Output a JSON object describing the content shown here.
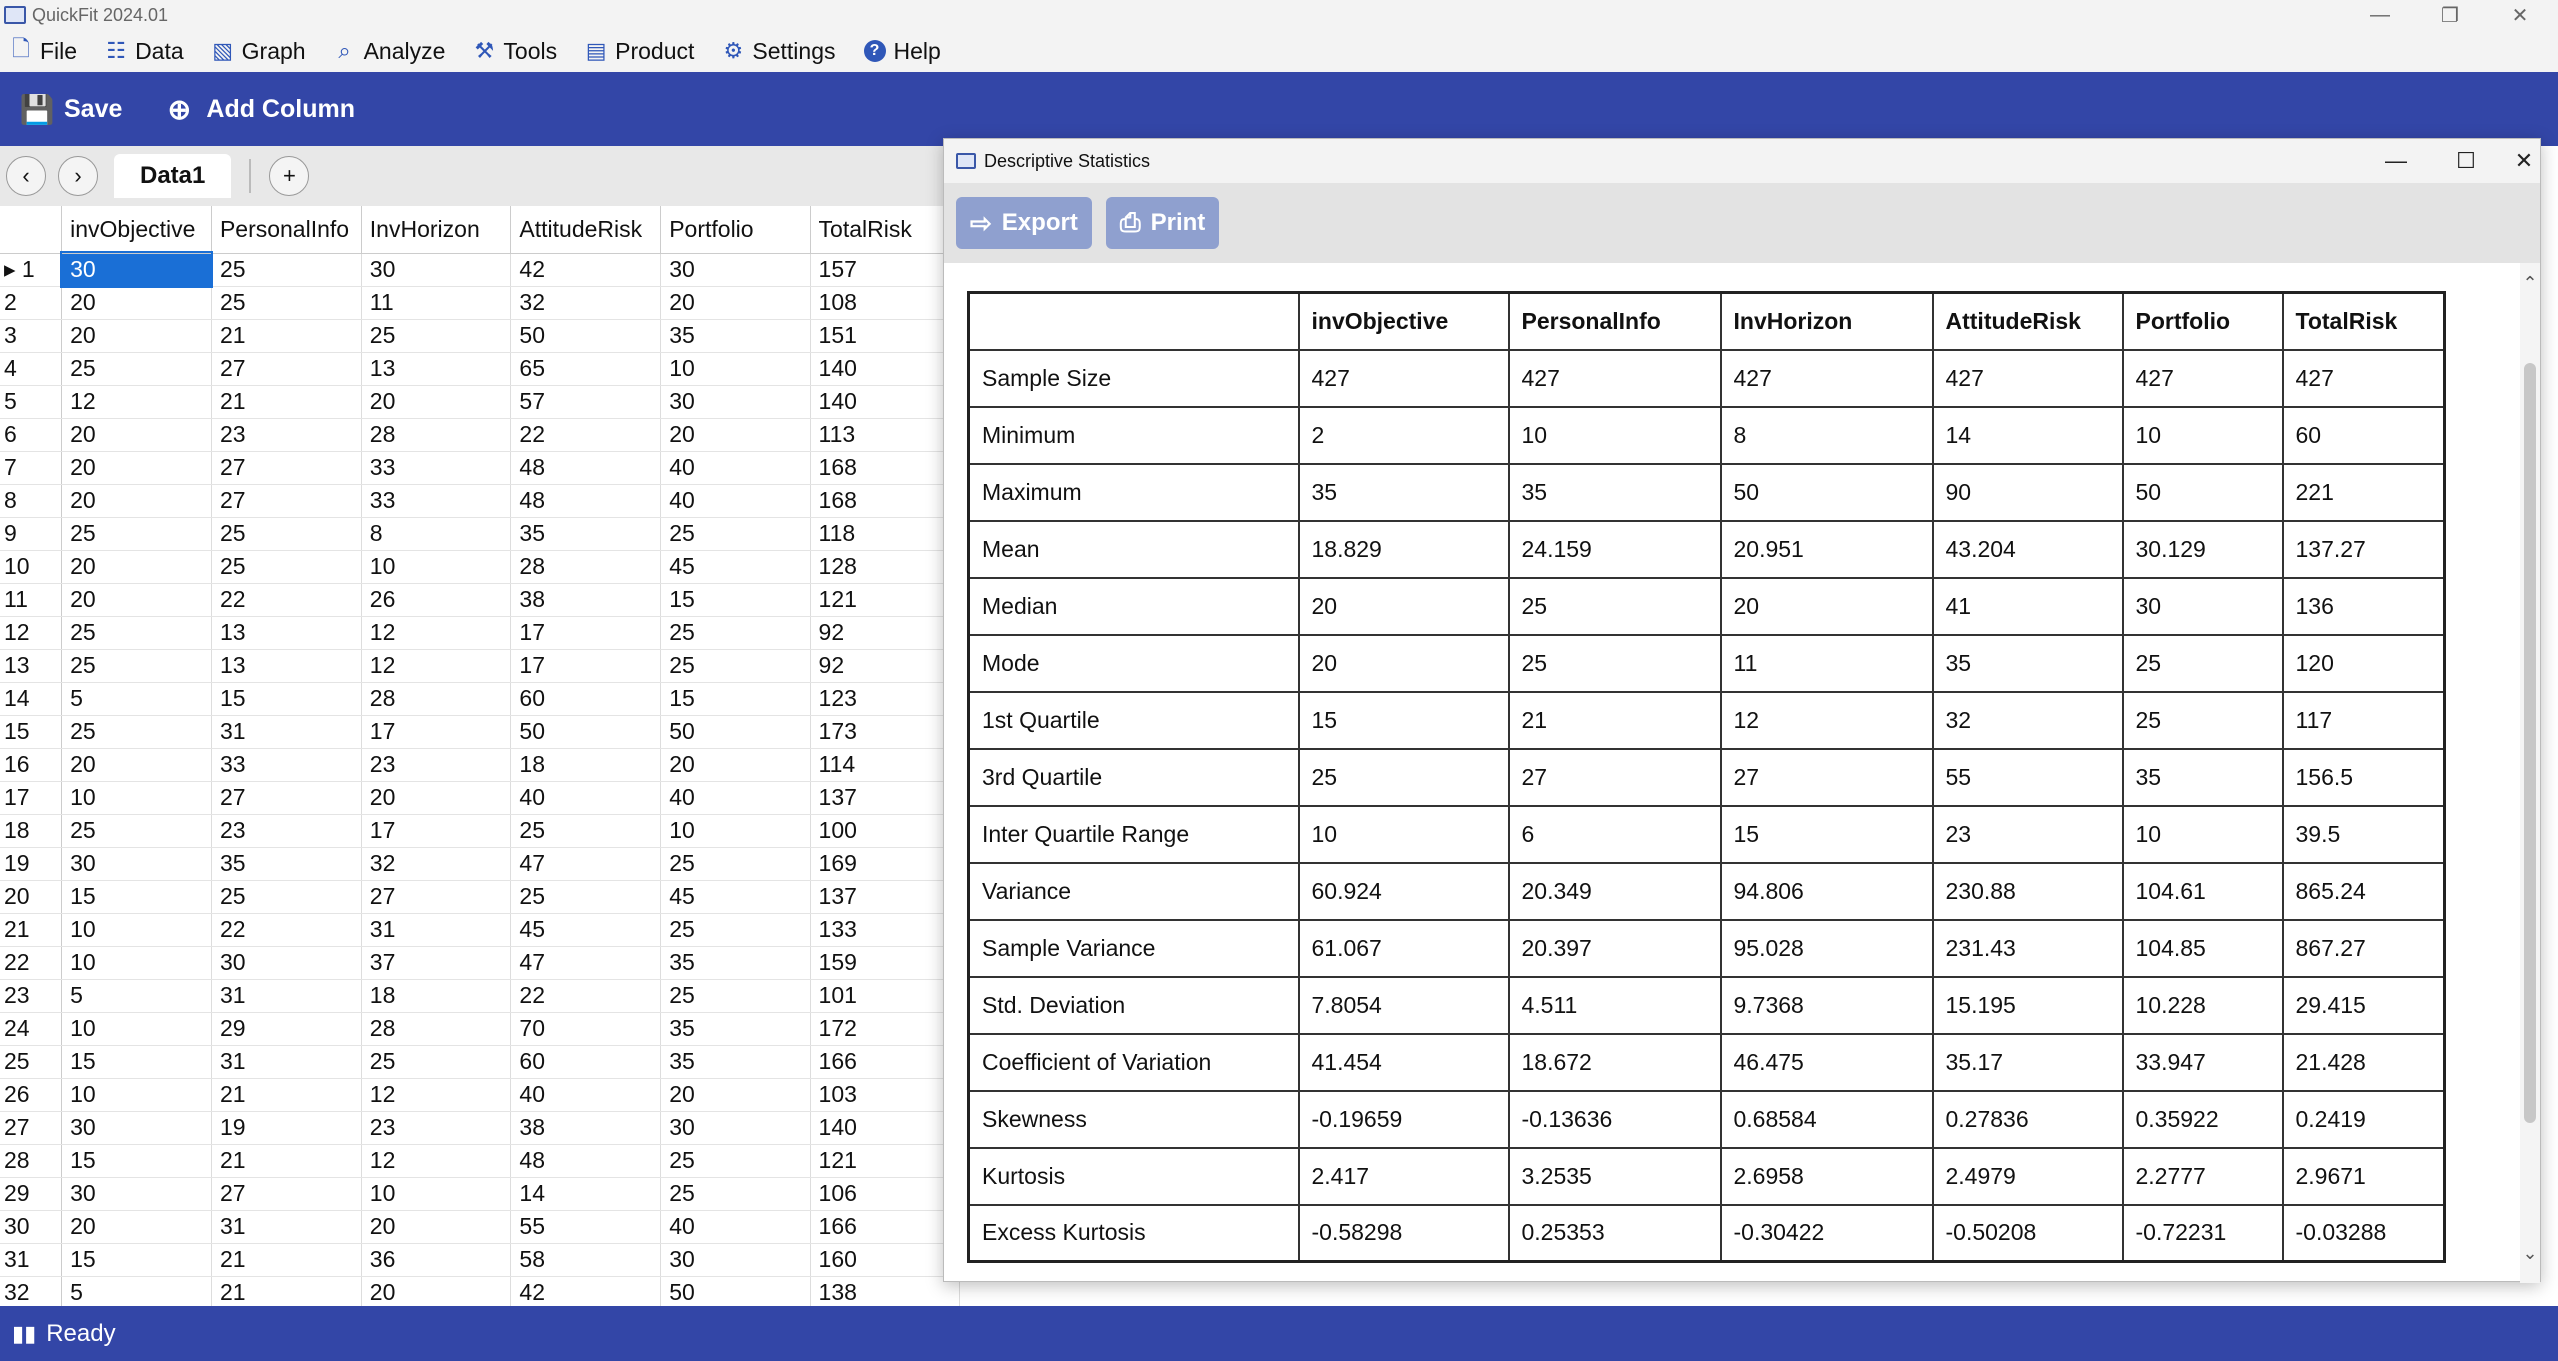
{
  "app": {
    "title": "QuickFit 2024.01"
  },
  "menu": [
    {
      "label": "File",
      "icon": "file-icon"
    },
    {
      "label": "Data",
      "icon": "database-icon"
    },
    {
      "label": "Graph",
      "icon": "graph-icon"
    },
    {
      "label": "Analyze",
      "icon": "analyze-icon"
    },
    {
      "label": "Tools",
      "icon": "tools-icon"
    },
    {
      "label": "Product",
      "icon": "product-icon"
    },
    {
      "label": "Settings",
      "icon": "gear-icon"
    },
    {
      "label": "Help",
      "icon": "help-icon"
    }
  ],
  "toolbar": {
    "save_label": "Save",
    "add_column_label": "Add Column"
  },
  "tabs": {
    "active": "Data1",
    "add": "+"
  },
  "grid": {
    "columns": [
      "invObjective",
      "PersonalInfo",
      "InvHorizon",
      "AttitudeRisk",
      "Portfolio",
      "TotalRisk"
    ],
    "rows": [
      [
        "1",
        "30",
        "25",
        "30",
        "42",
        "30",
        "157"
      ],
      [
        "2",
        "20",
        "25",
        "11",
        "32",
        "20",
        "108"
      ],
      [
        "3",
        "20",
        "21",
        "25",
        "50",
        "35",
        "151"
      ],
      [
        "4",
        "25",
        "27",
        "13",
        "65",
        "10",
        "140"
      ],
      [
        "5",
        "12",
        "21",
        "20",
        "57",
        "30",
        "140"
      ],
      [
        "6",
        "20",
        "23",
        "28",
        "22",
        "20",
        "113"
      ],
      [
        "7",
        "20",
        "27",
        "33",
        "48",
        "40",
        "168"
      ],
      [
        "8",
        "20",
        "27",
        "33",
        "48",
        "40",
        "168"
      ],
      [
        "9",
        "25",
        "25",
        "8",
        "35",
        "25",
        "118"
      ],
      [
        "10",
        "20",
        "25",
        "10",
        "28",
        "45",
        "128"
      ],
      [
        "11",
        "20",
        "22",
        "26",
        "38",
        "15",
        "121"
      ],
      [
        "12",
        "25",
        "13",
        "12",
        "17",
        "25",
        "92"
      ],
      [
        "13",
        "25",
        "13",
        "12",
        "17",
        "25",
        "92"
      ],
      [
        "14",
        "5",
        "15",
        "28",
        "60",
        "15",
        "123"
      ],
      [
        "15",
        "25",
        "31",
        "17",
        "50",
        "50",
        "173"
      ],
      [
        "16",
        "20",
        "33",
        "23",
        "18",
        "20",
        "114"
      ],
      [
        "17",
        "10",
        "27",
        "20",
        "40",
        "40",
        "137"
      ],
      [
        "18",
        "25",
        "23",
        "17",
        "25",
        "10",
        "100"
      ],
      [
        "19",
        "30",
        "35",
        "32",
        "47",
        "25",
        "169"
      ],
      [
        "20",
        "15",
        "25",
        "27",
        "25",
        "45",
        "137"
      ],
      [
        "21",
        "10",
        "22",
        "31",
        "45",
        "25",
        "133"
      ],
      [
        "22",
        "10",
        "30",
        "37",
        "47",
        "35",
        "159"
      ],
      [
        "23",
        "5",
        "31",
        "18",
        "22",
        "25",
        "101"
      ],
      [
        "24",
        "10",
        "29",
        "28",
        "70",
        "35",
        "172"
      ],
      [
        "25",
        "15",
        "31",
        "25",
        "60",
        "35",
        "166"
      ],
      [
        "26",
        "10",
        "21",
        "12",
        "40",
        "20",
        "103"
      ],
      [
        "27",
        "30",
        "19",
        "23",
        "38",
        "30",
        "140"
      ],
      [
        "28",
        "15",
        "21",
        "12",
        "48",
        "25",
        "121"
      ],
      [
        "29",
        "30",
        "27",
        "10",
        "14",
        "25",
        "106"
      ],
      [
        "30",
        "20",
        "31",
        "20",
        "55",
        "40",
        "166"
      ],
      [
        "31",
        "15",
        "21",
        "36",
        "58",
        "30",
        "160"
      ],
      [
        "32",
        "5",
        "21",
        "20",
        "42",
        "50",
        "138"
      ]
    ]
  },
  "dialog": {
    "title": "Descriptive Statistics",
    "export_label": "Export",
    "print_label": "Print",
    "columns": [
      "invObjective",
      "PersonalInfo",
      "InvHorizon",
      "AttitudeRisk",
      "Portfolio",
      "TotalRisk"
    ],
    "rows": [
      {
        "label": "Sample Size",
        "values": [
          "427",
          "427",
          "427",
          "427",
          "427",
          "427"
        ]
      },
      {
        "label": "Minimum",
        "values": [
          "2",
          "10",
          "8",
          "14",
          "10",
          "60"
        ]
      },
      {
        "label": "Maximum",
        "values": [
          "35",
          "35",
          "50",
          "90",
          "50",
          "221"
        ]
      },
      {
        "label": "Mean",
        "values": [
          "18.829",
          "24.159",
          "20.951",
          "43.204",
          "30.129",
          "137.27"
        ]
      },
      {
        "label": "Median",
        "values": [
          "20",
          "25",
          "20",
          "41",
          "30",
          "136"
        ]
      },
      {
        "label": "Mode",
        "values": [
          "20",
          "25",
          "11",
          "35",
          "25",
          "120"
        ]
      },
      {
        "label": "1st Quartile",
        "values": [
          "15",
          "21",
          "12",
          "32",
          "25",
          "117"
        ]
      },
      {
        "label": "3rd Quartile",
        "values": [
          "25",
          "27",
          "27",
          "55",
          "35",
          "156.5"
        ]
      },
      {
        "label": "Inter Quartile Range",
        "values": [
          "10",
          "6",
          "15",
          "23",
          "10",
          "39.5"
        ]
      },
      {
        "label": "Variance",
        "values": [
          "60.924",
          "20.349",
          "94.806",
          "230.88",
          "104.61",
          "865.24"
        ]
      },
      {
        "label": "Sample Variance",
        "values": [
          "61.067",
          "20.397",
          "95.028",
          "231.43",
          "104.85",
          "867.27"
        ]
      },
      {
        "label": "Std. Deviation",
        "values": [
          "7.8054",
          "4.511",
          "9.7368",
          "15.195",
          "10.228",
          "29.415"
        ]
      },
      {
        "label": "Coefficient of Variation",
        "values": [
          "41.454",
          "18.672",
          "46.475",
          "35.17",
          "33.947",
          "21.428"
        ]
      },
      {
        "label": "Skewness",
        "values": [
          "-0.19659",
          "-0.13636",
          "0.68584",
          "0.27836",
          "0.35922",
          "0.2419"
        ]
      },
      {
        "label": "Kurtosis",
        "values": [
          "2.417",
          "3.2535",
          "2.6958",
          "2.4979",
          "2.2777",
          "2.9671"
        ]
      },
      {
        "label": "Excess Kurtosis",
        "values": [
          "-0.58298",
          "0.25353",
          "-0.30422",
          "-0.50208",
          "-0.72231",
          "-0.03288"
        ]
      }
    ]
  },
  "status": {
    "text": "Ready"
  },
  "colors": {
    "accent": "#3346a7",
    "selection": "#1a6fd6",
    "dialog_button": "#8fa0cf"
  }
}
